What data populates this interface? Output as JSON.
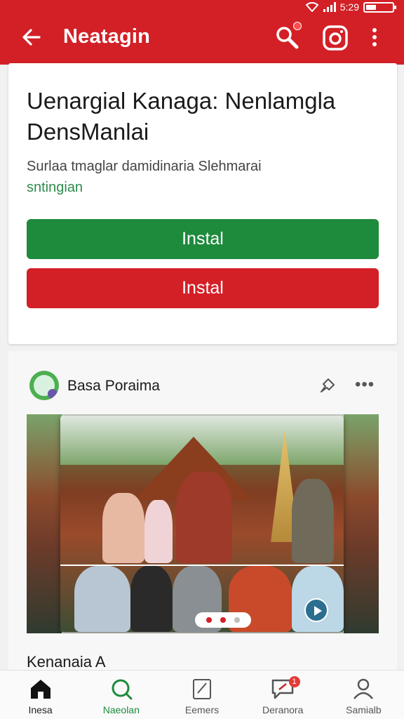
{
  "status_bar": {
    "time": "5:29"
  },
  "app_bar": {
    "title": "Neatagin"
  },
  "card": {
    "title": "Uenargial Kanaga: Nenlamgla DensManlai",
    "subtitle": "Surlaa tmaglar damidinaria Slehmarai",
    "subtitle_link": "sntingian",
    "button_primary": "Instal",
    "button_secondary": "Instal"
  },
  "post": {
    "author": "Basa Poraima",
    "caption": "Kenanaia A"
  },
  "bottom_nav": {
    "items": [
      {
        "label": "Inesa",
        "icon": "home-icon"
      },
      {
        "label": "Naeolan",
        "icon": "search-icon"
      },
      {
        "label": "Eemers",
        "icon": "edit-icon"
      },
      {
        "label": "Deranora",
        "icon": "chat-icon",
        "badge": "1"
      },
      {
        "label": "Samialb",
        "icon": "profile-icon"
      }
    ]
  },
  "colors": {
    "brand_red": "#d32027",
    "brand_green": "#1e8a3c"
  }
}
